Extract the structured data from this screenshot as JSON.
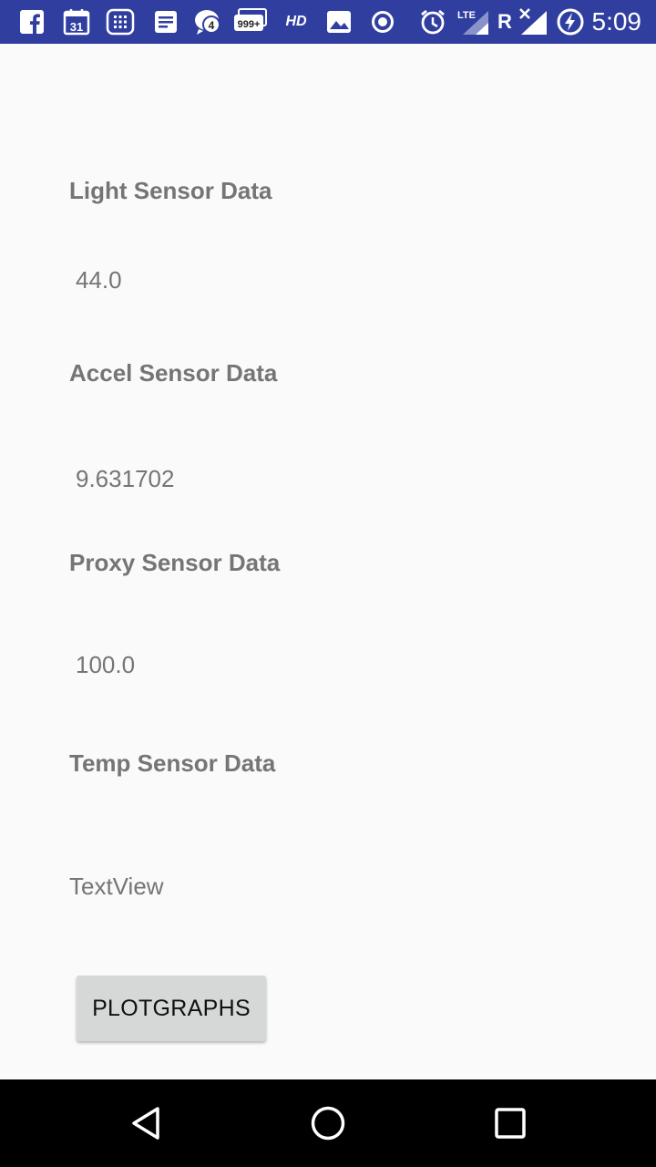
{
  "status_bar": {
    "time": "5:09",
    "calendar_day": "31",
    "messenger_badge": "4",
    "notifications_badge": "999+",
    "hd_label": "HD",
    "lte_label": "LTE",
    "roaming_label": "R",
    "icons": [
      "facebook-icon",
      "calendar-icon",
      "keypad-icon",
      "docs-icon",
      "messenger-icon",
      "notifications-icon",
      "hd-icon",
      "gallery-icon",
      "record-icon",
      "alarm-icon",
      "signal-lte-icon",
      "roaming-icon",
      "no-signal-icon",
      "battery-charging-icon"
    ],
    "background_color": "#303f9f"
  },
  "sensors": {
    "light": {
      "label": "Light Sensor Data",
      "value": "44.0"
    },
    "accel": {
      "label": "Accel Sensor Data",
      "value": "9.631702"
    },
    "proxy": {
      "label": "Proxy Sensor Data",
      "value": "100.0"
    },
    "temp": {
      "label": "Temp Sensor Data",
      "value": "TextView"
    }
  },
  "plot_button": {
    "label": "PLOTGRAPHS"
  },
  "nav_bar": {
    "icons": [
      "back-icon",
      "home-icon",
      "recents-icon"
    ]
  }
}
